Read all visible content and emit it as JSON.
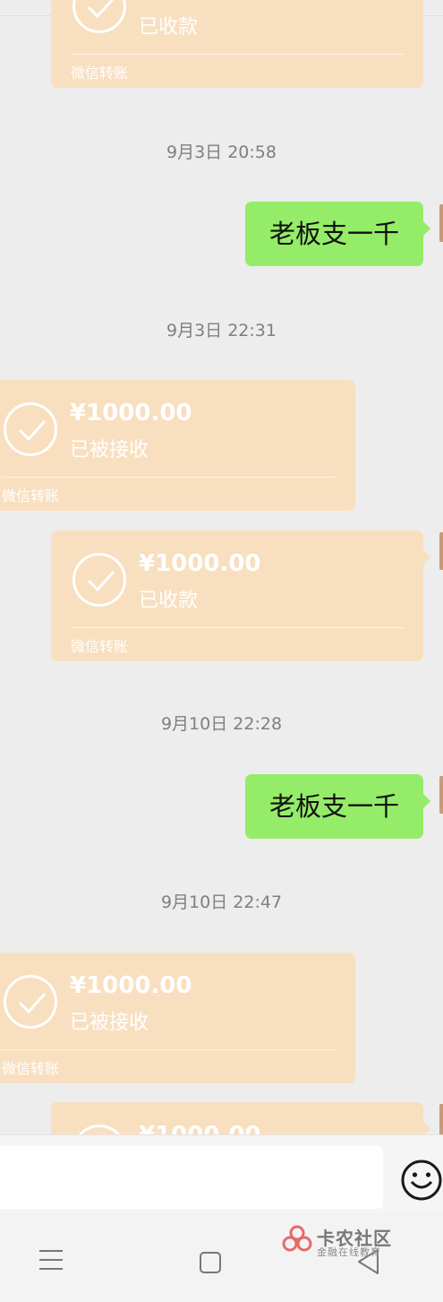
{
  "messages": {
    "top_partial": {
      "status": "已收款",
      "label": "微信转账"
    },
    "ts1": "9月3日 20:58",
    "text1": "老板支一千",
    "ts2": "9月3日 22:31",
    "transfer1": {
      "amount": "¥1000.00",
      "status": "已被接收",
      "label": "微信转账"
    },
    "transfer2": {
      "amount": "¥1000.00",
      "status": "已收款",
      "label": "微信转账"
    },
    "ts3": "9月10日 22:28",
    "text2": "老板支一千",
    "ts4": "9月10日 22:47",
    "transfer3": {
      "amount": "¥1000.00",
      "status": "已被接收",
      "label": "微信转账"
    },
    "bottom_partial": {
      "amount": "¥1000.00"
    }
  },
  "watermark": {
    "title": "卡农社区",
    "subtitle": "金融在线教育"
  },
  "colors": {
    "background": "#ededed",
    "transfer_card": "#f8dfc0",
    "sent_bubble": "#95ec69",
    "timestamp": "#7f7f7f"
  },
  "icons": {
    "transfer_status": "check-circle-icon",
    "emoji": "emoji-icon",
    "nav_menu": "menu-icon",
    "nav_home": "home-icon",
    "nav_back": "back-icon"
  }
}
